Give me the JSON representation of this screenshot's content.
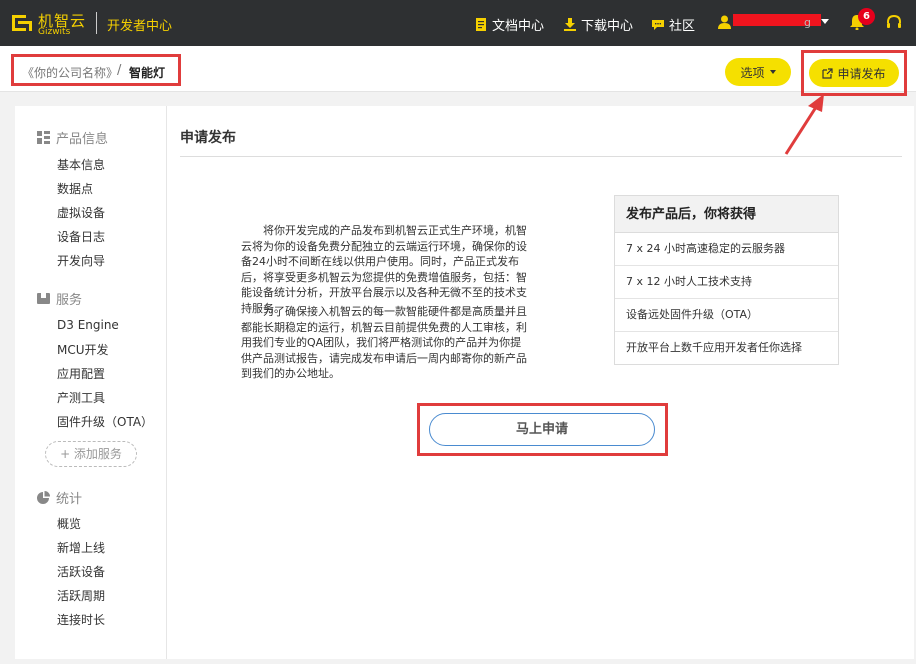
{
  "topbar": {
    "logo_cn": "机智云",
    "logo_en": "Gizwits",
    "dev_center": "开发者中心",
    "nav": [
      {
        "label": "文档中心",
        "icon": "document-icon"
      },
      {
        "label": "下载中心",
        "icon": "download-icon"
      },
      {
        "label": "社区",
        "icon": "chat-icon"
      }
    ],
    "user_tail": "g",
    "notification_count": "6",
    "colors": {
      "bar": "#2e3032",
      "accent": "#f5d000",
      "badge": "#e6001c",
      "redaction": "#f0141e"
    }
  },
  "subheader": {
    "company": "《你的公司名称》",
    "separator": "/",
    "product": "智能灯",
    "options_label": "选项",
    "publish_label": "申请发布"
  },
  "sidebar": {
    "groups": [
      {
        "label": "产品信息",
        "icon": "grid-icon",
        "items": [
          "基本信息",
          "数据点",
          "虚拟设备",
          "设备日志",
          "开发向导"
        ]
      },
      {
        "label": "服务",
        "icon": "package-icon",
        "items": [
          "D3 Engine",
          "MCU开发",
          "应用配置",
          "产测工具",
          "固件升级（OTA）"
        ]
      },
      {
        "label": "统计",
        "icon": "pie-icon",
        "items": [
          "概览",
          "新增上线",
          "活跃设备",
          "活跃周期",
          "连接时长"
        ]
      }
    ],
    "add_service": "+ 添加服务"
  },
  "content": {
    "title": "申请发布",
    "para1": "将你开发完成的产品发布到机智云正式生产环境，机智云将为你的设备免费分配独立的云端运行环境，确保你的设备24小时不间断在线以供用户使用。同时，产品正式发布后，将享受更多机智云为您提供的免费增值服务，包括：智能设备统计分析，开放平台展示以及各种无微不至的技术支持服务。",
    "para2": "为了确保接入机智云的每一款智能硬件都是高质量并且都能长期稳定的运行，机智云目前提供免费的人工审核，利用我们专业的QA团队，我们将严格测试你的产品并为你提供产品测试报告，请完成发布申请后一周内邮寄你的新产品到我们的办公地址。",
    "benefits_title": "发布产品后，你将获得",
    "benefits": [
      "7 x 24 小时高速稳定的云服务器",
      "7 x 12 小时人工技术支持",
      "设备远处固件升级（OTA）",
      "开放平台上数千应用开发者任你选择"
    ],
    "apply_label": "马上申请"
  }
}
